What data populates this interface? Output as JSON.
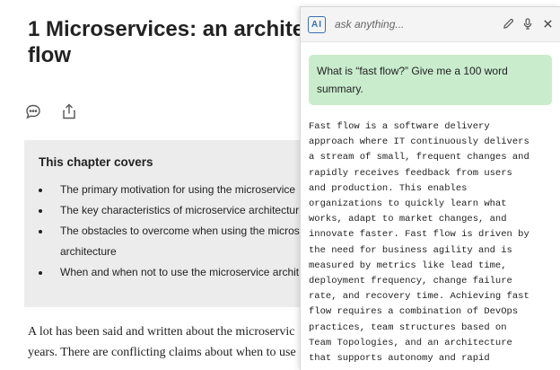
{
  "document": {
    "title_lines": [
      "1 Microservices: an architec",
      "flow"
    ],
    "chapter_covers": {
      "heading": "This chapter covers",
      "items": [
        [
          "The primary motivation for using the microservice"
        ],
        [
          "The key characteristics of microservice architectur"
        ],
        [
          "The obstacles to overcome when using the microse",
          "architecture"
        ],
        [
          "When and when not to use the microservice archit"
        ]
      ]
    },
    "paragraph_lines": [
      "A lot has been said and written about the microservic",
      "years. There are conflicting claims about when to use"
    ]
  },
  "ai_panel": {
    "badge": "AI",
    "placeholder": "ask anything...",
    "question_lines": [
      "What is “fast flow?” Give me a 100 word",
      "summary."
    ],
    "answer_lines": [
      "Fast flow is a software delivery",
      "approach where IT continuously delivers",
      "a stream of small, frequent changes and",
      "rapidly receives feedback from users",
      "and production. This enables",
      "organizations to quickly learn what",
      "works, adapt to market changes, and",
      "innovate faster. Fast flow is driven by",
      "the need for business agility and is",
      "measured by metrics like lead time,",
      "deployment frequency, change failure",
      "rate, and recovery time. Achieving fast",
      "flow requires a combination of DevOps",
      "practices, team structures based on",
      "Team Topologies, and an architecture",
      "that supports autonomy and rapid"
    ]
  },
  "icons": {
    "comment": "comment-icon",
    "share": "share-icon",
    "edit": "pencil-icon",
    "mic": "microphone-icon",
    "close": "close-icon"
  }
}
